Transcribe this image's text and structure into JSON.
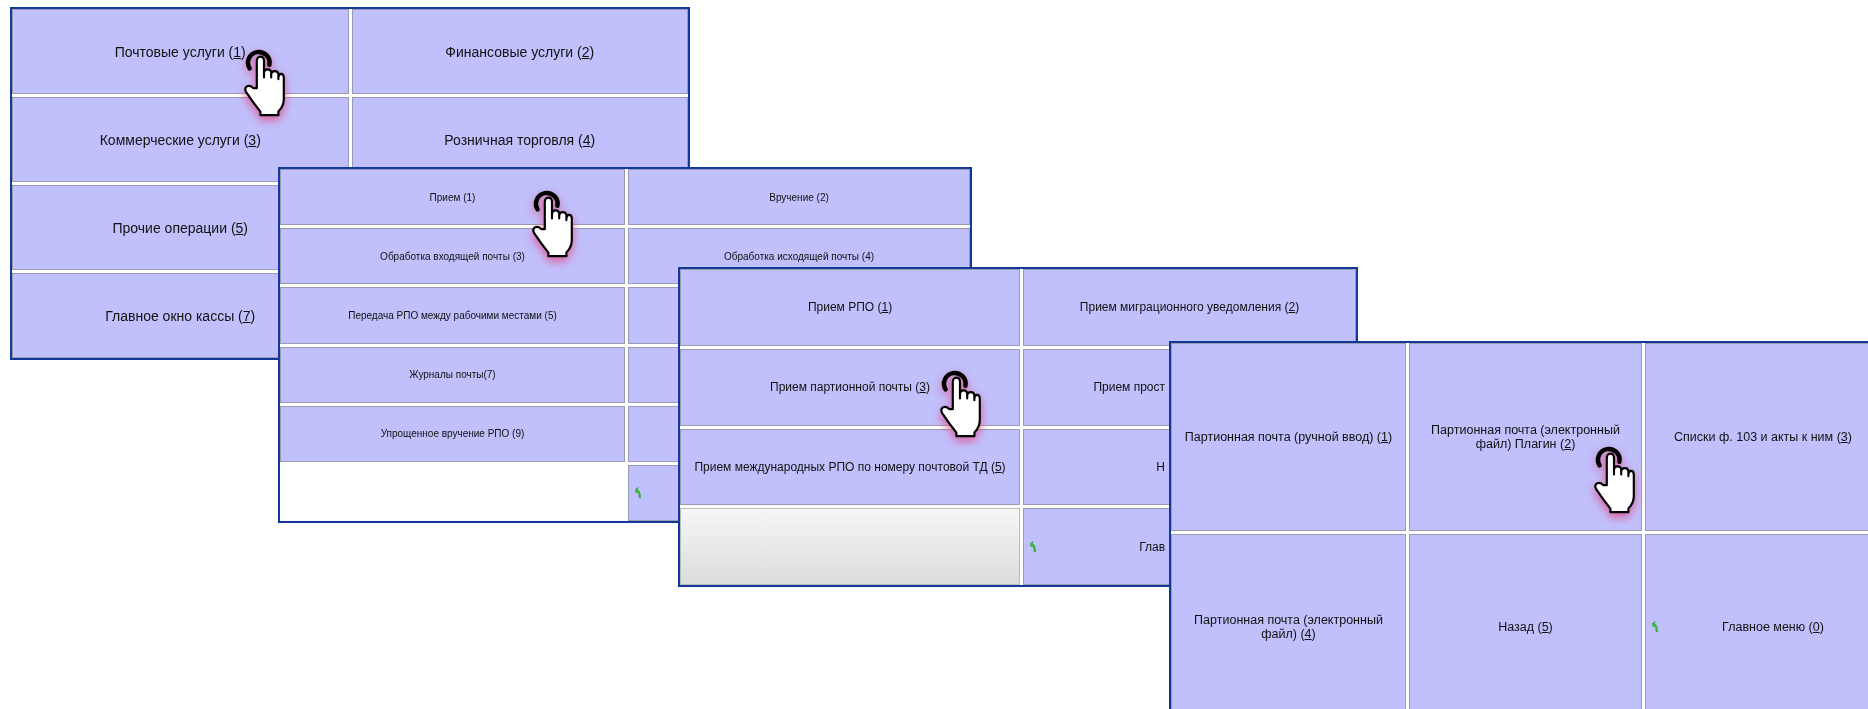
{
  "windows": [
    {
      "buttons": [
        {
          "kind": "menu",
          "label": "Почтовые услуги (",
          "hotkey": "1",
          "tail": ")"
        },
        {
          "kind": "menu",
          "label": "Финансовые услуги (",
          "hotkey": "2",
          "tail": ")"
        },
        {
          "kind": "menu",
          "label": "Коммерческие услуги (",
          "hotkey": "3",
          "tail": ")"
        },
        {
          "kind": "menu",
          "label": "Розничная торговля (",
          "hotkey": "4",
          "tail": ")"
        },
        {
          "kind": "menu",
          "label": "Прочие операции (",
          "hotkey": "5",
          "tail": ")"
        },
        {
          "kind": "blank"
        },
        {
          "kind": "menu",
          "label": "Главное окно кассы (",
          "hotkey": "7",
          "tail": ")"
        }
      ]
    },
    {
      "buttons": [
        {
          "kind": "menu",
          "label": "Прием (1)"
        },
        {
          "kind": "menu",
          "label": "Вручение (2)"
        },
        {
          "kind": "menu",
          "label": "Обработка входящей почты (3)"
        },
        {
          "kind": "menu",
          "label": "Обработка исходящей почты (4)"
        },
        {
          "kind": "menu",
          "label": "Передача РПО между рабочими местами (5)"
        },
        {
          "kind": "menu"
        },
        {
          "kind": "menu",
          "label": "Журналы почты(7)"
        },
        {
          "kind": "menu"
        },
        {
          "kind": "menu",
          "label": "Упрощенное вручение РПО (9)"
        },
        {
          "kind": "menu"
        },
        {
          "kind": "blank"
        },
        {
          "kind": "home"
        }
      ]
    },
    {
      "buttons": [
        {
          "kind": "menu",
          "label": "Прием РПО (",
          "hotkey": "1",
          "tail": ")"
        },
        {
          "kind": "menu",
          "label": "Прием миграционного уведомления (",
          "hotkey": "2",
          "tail": ")"
        },
        {
          "kind": "menu",
          "label": "Прием партионной почты (",
          "hotkey": "3",
          "tail": ")"
        },
        {
          "kind": "menu",
          "label": "Прием прост",
          "cut": true
        },
        {
          "kind": "menu",
          "label": "Прием международных РПО по номеру почтовой ТД (",
          "hotkey": "5",
          "tail": ")"
        },
        {
          "kind": "menu",
          "label": "Н",
          "cut": true
        },
        {
          "kind": "disabled"
        },
        {
          "kind": "home",
          "label": "Глав",
          "cut": true
        }
      ]
    },
    {
      "buttons": [
        {
          "kind": "menu",
          "label": "Партионная почта (ручной ввод) (",
          "hotkey": "1",
          "tail": ")"
        },
        {
          "kind": "menu",
          "label": "Партионная почта (электронный файл) Плагин (",
          "hotkey": "2",
          "tail": ")"
        },
        {
          "kind": "menu",
          "label": "Списки ф. 103 и акты к ним (",
          "hotkey": "3",
          "tail": ")"
        },
        {
          "kind": "menu",
          "label": "Партионная почта (электронный файл) (",
          "hotkey": "4",
          "tail": ")"
        },
        {
          "kind": "menu",
          "label": "Назад (",
          "hotkey": "5",
          "tail": ")"
        },
        {
          "kind": "home",
          "label": "Главное меню (",
          "hotkey": "0",
          "tail": ")"
        }
      ]
    }
  ]
}
